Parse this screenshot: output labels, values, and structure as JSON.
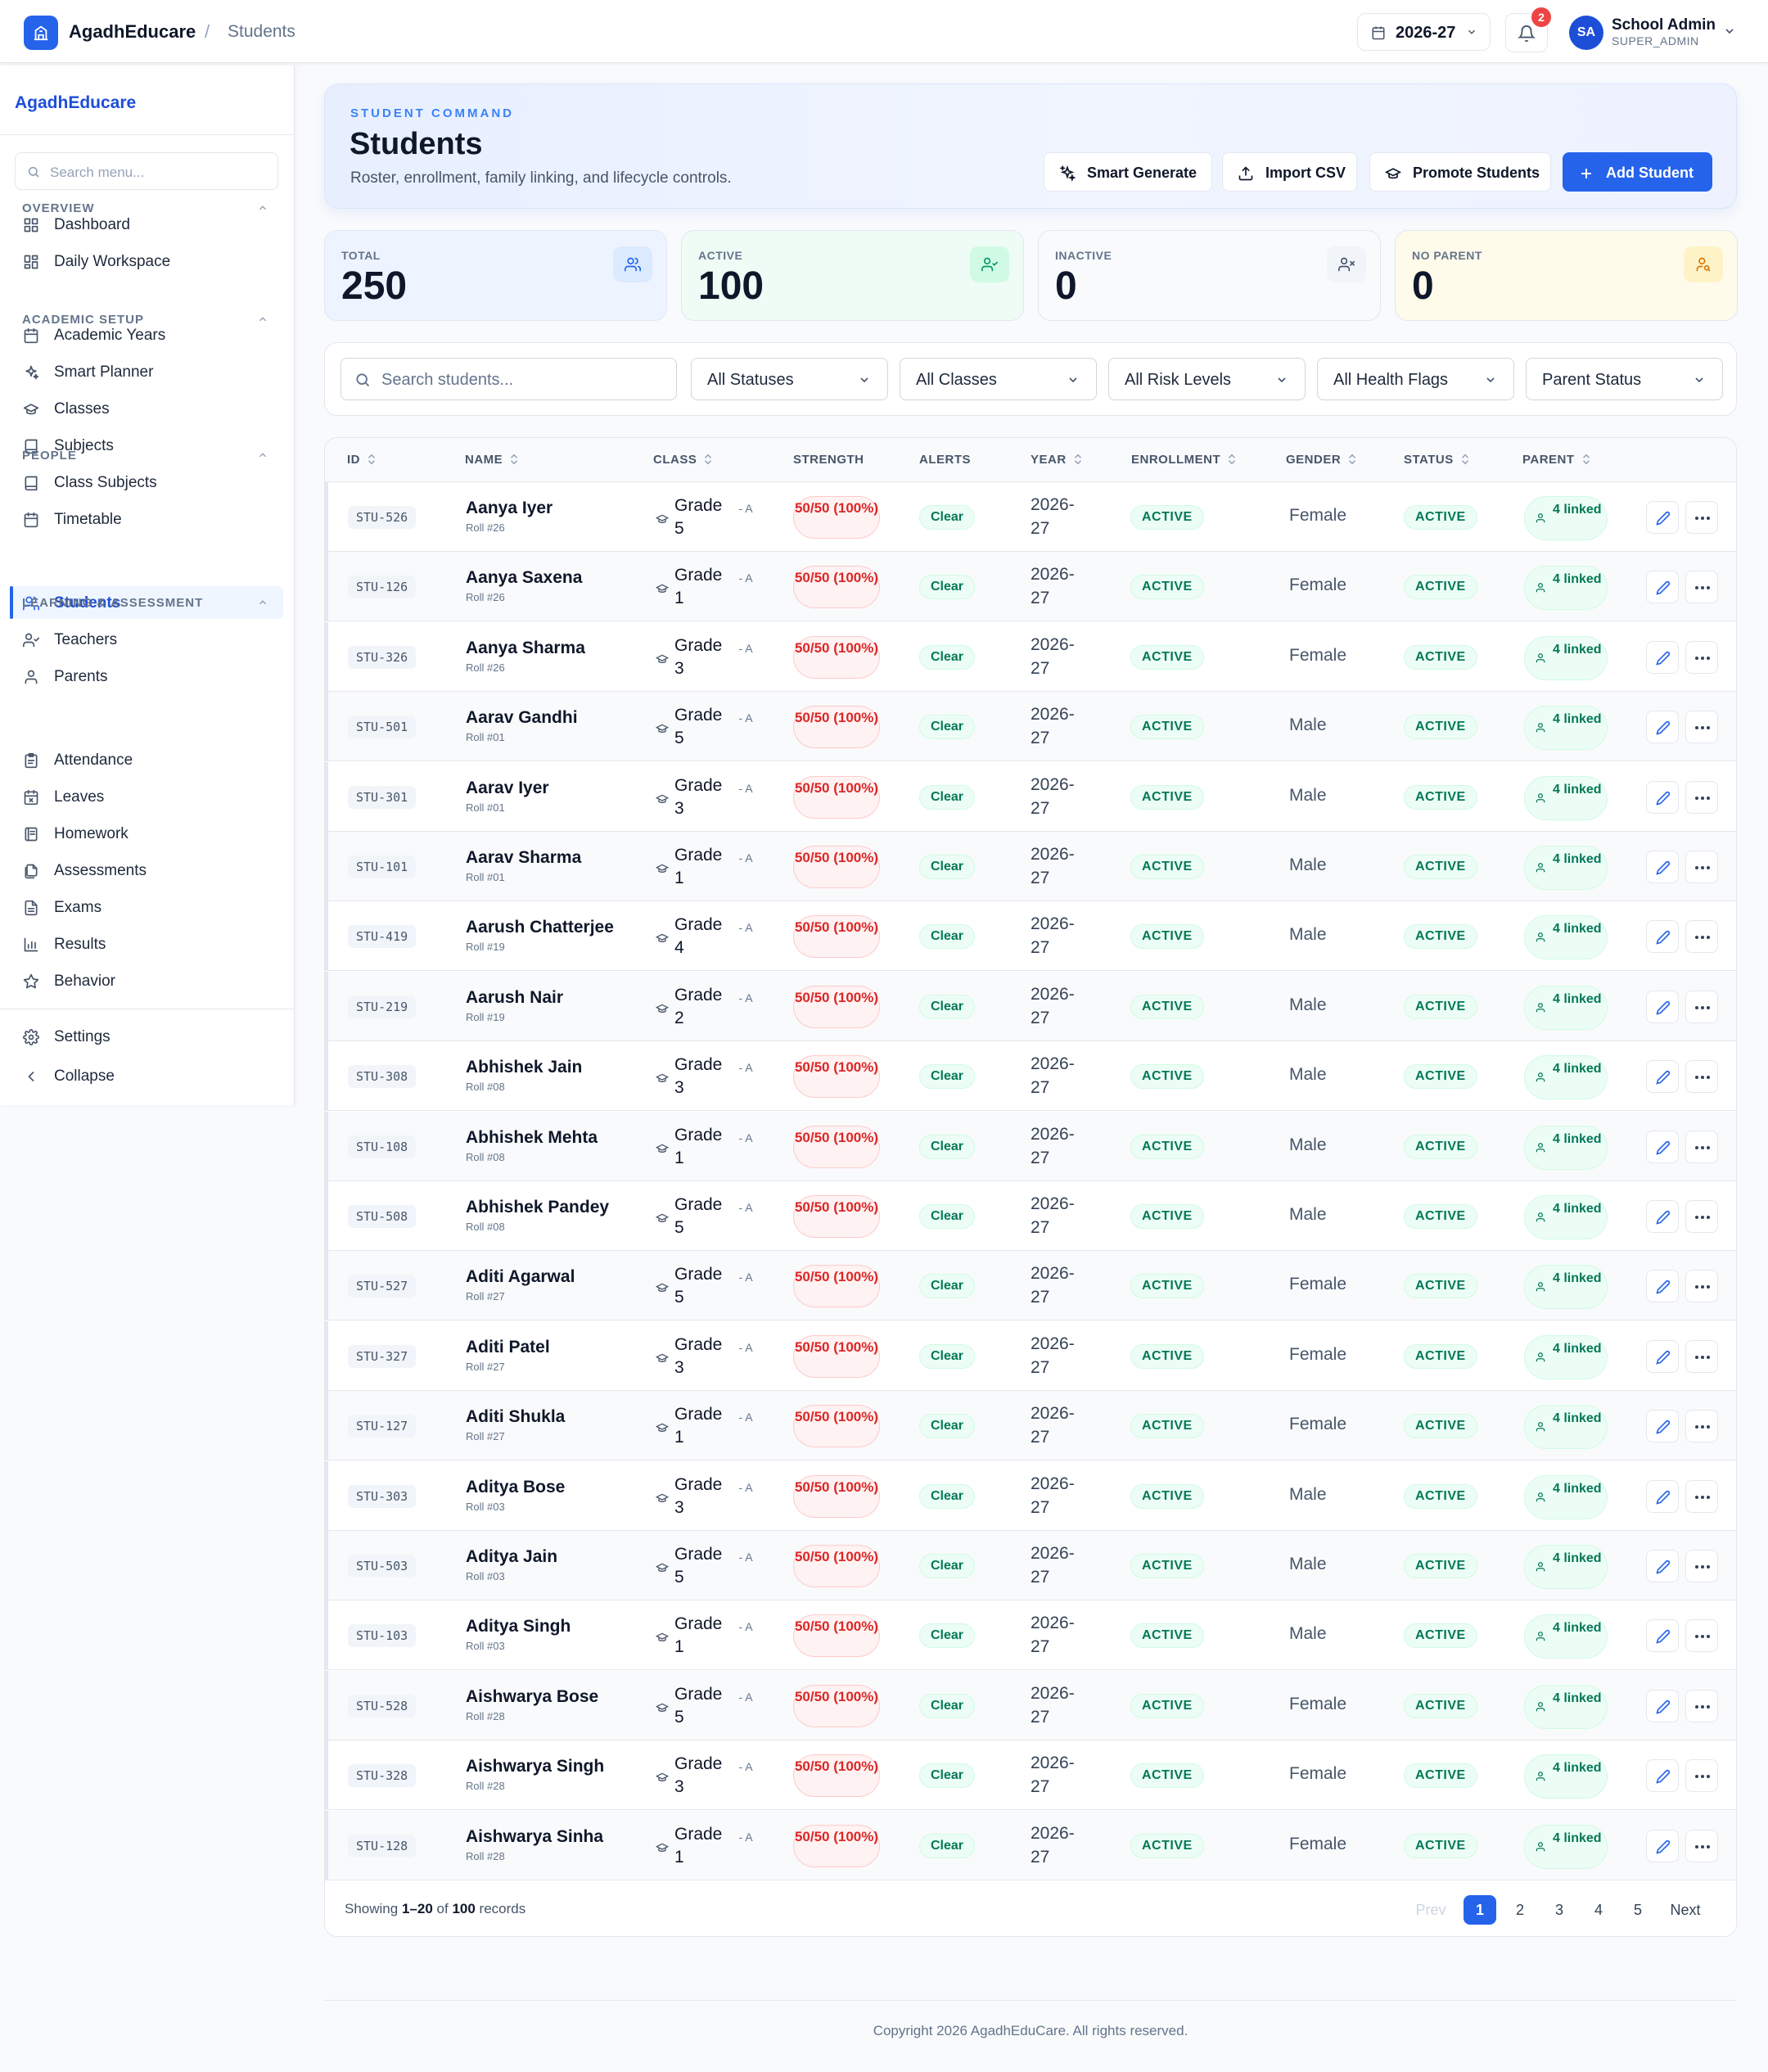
{
  "app": {
    "brand": "AgadhEducare",
    "breadcrumb": "Students",
    "year": "2026-27",
    "notifications": "2",
    "user": {
      "initials": "SA",
      "name": "School Admin",
      "role": "SUPER_ADMIN"
    }
  },
  "sidebar": {
    "brand": "AgadhEducare",
    "search_placeholder": "Search menu...",
    "sections": [
      {
        "title": "OVERVIEW",
        "items": [
          {
            "label": "Dashboard",
            "icon": "dashboard-icon"
          },
          {
            "label": "Daily Workspace",
            "icon": "workspace-icon"
          }
        ]
      },
      {
        "title": "ACADEMIC SETUP",
        "items": [
          {
            "label": "Academic Years",
            "icon": "calendar-icon"
          },
          {
            "label": "Smart Planner",
            "icon": "sparkles-icon"
          },
          {
            "label": "Classes",
            "icon": "graduation-cap-icon"
          },
          {
            "label": "Subjects",
            "icon": "book-icon"
          },
          {
            "label": "Class Subjects",
            "icon": "book-icon"
          },
          {
            "label": "Timetable",
            "icon": "calendar-icon"
          }
        ]
      },
      {
        "title": "PEOPLE",
        "items": [
          {
            "label": "Students",
            "icon": "users-icon",
            "active": true
          },
          {
            "label": "Teachers",
            "icon": "user-check-icon"
          },
          {
            "label": "Parents",
            "icon": "user-icon"
          }
        ]
      },
      {
        "title": "LEARNING & ASSESSMENT",
        "items": [
          {
            "label": "Attendance",
            "icon": "clipboard-icon"
          },
          {
            "label": "Leaves",
            "icon": "calendar-x-icon"
          },
          {
            "label": "Homework",
            "icon": "notebook-icon"
          },
          {
            "label": "Assessments",
            "icon": "files-icon"
          },
          {
            "label": "Exams",
            "icon": "document-icon"
          },
          {
            "label": "Results",
            "icon": "bar-chart-icon"
          },
          {
            "label": "Behavior",
            "icon": "star-icon"
          }
        ]
      }
    ],
    "settings": "Settings",
    "collapse": "Collapse"
  },
  "hero": {
    "kicker": "STUDENT COMMAND",
    "title": "Students",
    "subtitle": "Roster, enrollment, family linking, and lifecycle controls.",
    "buttons": {
      "smart": "Smart Generate",
      "import": "Import CSV",
      "promote": "Promote Students",
      "add": "Add Student"
    }
  },
  "stats": [
    {
      "label": "TOTAL",
      "value": "250",
      "bg": "#eef4ff",
      "icon_bg": "#dbeafe",
      "icon_color": "#2563eb"
    },
    {
      "label": "ACTIVE",
      "value": "100",
      "bg": "#eefcf5",
      "icon_bg": "#d1fae5",
      "icon_color": "#059669"
    },
    {
      "label": "INACTIVE",
      "value": "0",
      "bg": "#f8fafc",
      "icon_bg": "#f1f5f9",
      "icon_color": "#475569"
    },
    {
      "label": "NO PARENT",
      "value": "0",
      "bg": "#fffbeb",
      "icon_bg": "#fef3c7",
      "icon_color": "#d97706"
    }
  ],
  "filters": {
    "search_placeholder": "Search students...",
    "selects": [
      "All Statuses",
      "All Classes",
      "All Risk Levels",
      "All Health Flags",
      "Parent Status"
    ]
  },
  "table": {
    "headers": {
      "id": "ID",
      "name": "NAME",
      "class": "CLASS",
      "strength": "STRENGTH",
      "alerts": "ALERTS",
      "year": "YEAR",
      "enrollment": "ENROLLMENT",
      "gender": "GENDER",
      "status": "STATUS",
      "parent": "PARENT"
    },
    "rows": [
      {
        "id": "STU-526",
        "name": "Aanya Iyer",
        "roll": "Roll #26",
        "grade": "Grade 5",
        "section": "- A",
        "strength": "50/50 (100%)",
        "alert": "Clear",
        "year": "2026-27",
        "enrollment": "ACTIVE",
        "gender": "Female",
        "status": "ACTIVE",
        "parent": "4 linked"
      },
      {
        "id": "STU-126",
        "name": "Aanya Saxena",
        "roll": "Roll #26",
        "grade": "Grade 1",
        "section": "- A",
        "strength": "50/50 (100%)",
        "alert": "Clear",
        "year": "2026-27",
        "enrollment": "ACTIVE",
        "gender": "Female",
        "status": "ACTIVE",
        "parent": "4 linked"
      },
      {
        "id": "STU-326",
        "name": "Aanya Sharma",
        "roll": "Roll #26",
        "grade": "Grade 3",
        "section": "- A",
        "strength": "50/50 (100%)",
        "alert": "Clear",
        "year": "2026-27",
        "enrollment": "ACTIVE",
        "gender": "Female",
        "status": "ACTIVE",
        "parent": "4 linked"
      },
      {
        "id": "STU-501",
        "name": "Aarav Gandhi",
        "roll": "Roll #01",
        "grade": "Grade 5",
        "section": "- A",
        "strength": "50/50 (100%)",
        "alert": "Clear",
        "year": "2026-27",
        "enrollment": "ACTIVE",
        "gender": "Male",
        "status": "ACTIVE",
        "parent": "4 linked"
      },
      {
        "id": "STU-301",
        "name": "Aarav Iyer",
        "roll": "Roll #01",
        "grade": "Grade 3",
        "section": "- A",
        "strength": "50/50 (100%)",
        "alert": "Clear",
        "year": "2026-27",
        "enrollment": "ACTIVE",
        "gender": "Male",
        "status": "ACTIVE",
        "parent": "4 linked"
      },
      {
        "id": "STU-101",
        "name": "Aarav Sharma",
        "roll": "Roll #01",
        "grade": "Grade 1",
        "section": "- A",
        "strength": "50/50 (100%)",
        "alert": "Clear",
        "year": "2026-27",
        "enrollment": "ACTIVE",
        "gender": "Male",
        "status": "ACTIVE",
        "parent": "4 linked"
      },
      {
        "id": "STU-419",
        "name": "Aarush Chatterjee",
        "roll": "Roll #19",
        "grade": "Grade 4",
        "section": "- A",
        "strength": "50/50 (100%)",
        "alert": "Clear",
        "year": "2026-27",
        "enrollment": "ACTIVE",
        "gender": "Male",
        "status": "ACTIVE",
        "parent": "4 linked"
      },
      {
        "id": "STU-219",
        "name": "Aarush Nair",
        "roll": "Roll #19",
        "grade": "Grade 2",
        "section": "- A",
        "strength": "50/50 (100%)",
        "alert": "Clear",
        "year": "2026-27",
        "enrollment": "ACTIVE",
        "gender": "Male",
        "status": "ACTIVE",
        "parent": "4 linked"
      },
      {
        "id": "STU-308",
        "name": "Abhishek Jain",
        "roll": "Roll #08",
        "grade": "Grade 3",
        "section": "- A",
        "strength": "50/50 (100%)",
        "alert": "Clear",
        "year": "2026-27",
        "enrollment": "ACTIVE",
        "gender": "Male",
        "status": "ACTIVE",
        "parent": "4 linked"
      },
      {
        "id": "STU-108",
        "name": "Abhishek Mehta",
        "roll": "Roll #08",
        "grade": "Grade 1",
        "section": "- A",
        "strength": "50/50 (100%)",
        "alert": "Clear",
        "year": "2026-27",
        "enrollment": "ACTIVE",
        "gender": "Male",
        "status": "ACTIVE",
        "parent": "4 linked"
      },
      {
        "id": "STU-508",
        "name": "Abhishek Pandey",
        "roll": "Roll #08",
        "grade": "Grade 5",
        "section": "- A",
        "strength": "50/50 (100%)",
        "alert": "Clear",
        "year": "2026-27",
        "enrollment": "ACTIVE",
        "gender": "Male",
        "status": "ACTIVE",
        "parent": "4 linked"
      },
      {
        "id": "STU-527",
        "name": "Aditi Agarwal",
        "roll": "Roll #27",
        "grade": "Grade 5",
        "section": "- A",
        "strength": "50/50 (100%)",
        "alert": "Clear",
        "year": "2026-27",
        "enrollment": "ACTIVE",
        "gender": "Female",
        "status": "ACTIVE",
        "parent": "4 linked"
      },
      {
        "id": "STU-327",
        "name": "Aditi Patel",
        "roll": "Roll #27",
        "grade": "Grade 3",
        "section": "- A",
        "strength": "50/50 (100%)",
        "alert": "Clear",
        "year": "2026-27",
        "enrollment": "ACTIVE",
        "gender": "Female",
        "status": "ACTIVE",
        "parent": "4 linked"
      },
      {
        "id": "STU-127",
        "name": "Aditi Shukla",
        "roll": "Roll #27",
        "grade": "Grade 1",
        "section": "- A",
        "strength": "50/50 (100%)",
        "alert": "Clear",
        "year": "2026-27",
        "enrollment": "ACTIVE",
        "gender": "Female",
        "status": "ACTIVE",
        "parent": "4 linked"
      },
      {
        "id": "STU-303",
        "name": "Aditya Bose",
        "roll": "Roll #03",
        "grade": "Grade 3",
        "section": "- A",
        "strength": "50/50 (100%)",
        "alert": "Clear",
        "year": "2026-27",
        "enrollment": "ACTIVE",
        "gender": "Male",
        "status": "ACTIVE",
        "parent": "4 linked"
      },
      {
        "id": "STU-503",
        "name": "Aditya Jain",
        "roll": "Roll #03",
        "grade": "Grade 5",
        "section": "- A",
        "strength": "50/50 (100%)",
        "alert": "Clear",
        "year": "2026-27",
        "enrollment": "ACTIVE",
        "gender": "Male",
        "status": "ACTIVE",
        "parent": "4 linked"
      },
      {
        "id": "STU-103",
        "name": "Aditya Singh",
        "roll": "Roll #03",
        "grade": "Grade 1",
        "section": "- A",
        "strength": "50/50 (100%)",
        "alert": "Clear",
        "year": "2026-27",
        "enrollment": "ACTIVE",
        "gender": "Male",
        "status": "ACTIVE",
        "parent": "4 linked"
      },
      {
        "id": "STU-528",
        "name": "Aishwarya Bose",
        "roll": "Roll #28",
        "grade": "Grade 5",
        "section": "- A",
        "strength": "50/50 (100%)",
        "alert": "Clear",
        "year": "2026-27",
        "enrollment": "ACTIVE",
        "gender": "Female",
        "status": "ACTIVE",
        "parent": "4 linked"
      },
      {
        "id": "STU-328",
        "name": "Aishwarya Singh",
        "roll": "Roll #28",
        "grade": "Grade 3",
        "section": "- A",
        "strength": "50/50 (100%)",
        "alert": "Clear",
        "year": "2026-27",
        "enrollment": "ACTIVE",
        "gender": "Female",
        "status": "ACTIVE",
        "parent": "4 linked"
      },
      {
        "id": "STU-128",
        "name": "Aishwarya Sinha",
        "roll": "Roll #28",
        "grade": "Grade 1",
        "section": "- A",
        "strength": "50/50 (100%)",
        "alert": "Clear",
        "year": "2026-27",
        "enrollment": "ACTIVE",
        "gender": "Female",
        "status": "ACTIVE",
        "parent": "4 linked"
      }
    ],
    "footer": {
      "showing": "Showing",
      "range": "1–20",
      "of": "of",
      "total": "100",
      "records": "records"
    },
    "pagination": {
      "prev": "Prev",
      "pages": [
        "1",
        "2",
        "3",
        "4",
        "5"
      ],
      "current": "1",
      "next": "Next"
    }
  },
  "footer": {
    "copyright": "Copyright 2026 AgadhEduCare. All rights reserved."
  }
}
